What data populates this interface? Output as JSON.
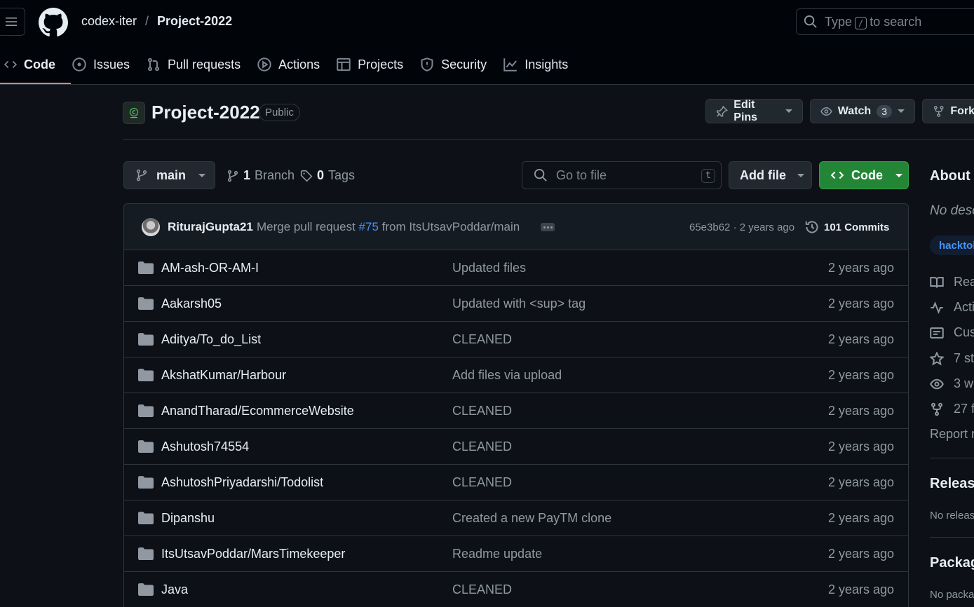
{
  "header": {
    "owner": "codex-iter",
    "separator": "/",
    "repo": "Project-2022",
    "search_prefix": "Type",
    "search_key": "/",
    "search_suffix": "to search"
  },
  "tabs": [
    {
      "label": "Code",
      "icon": "code-icon",
      "active": true
    },
    {
      "label": "Issues",
      "icon": "issue-icon"
    },
    {
      "label": "Pull requests",
      "icon": "pull-request-icon"
    },
    {
      "label": "Actions",
      "icon": "play-icon"
    },
    {
      "label": "Projects",
      "icon": "table-icon"
    },
    {
      "label": "Security",
      "icon": "shield-icon"
    },
    {
      "label": "Insights",
      "icon": "graph-icon"
    }
  ],
  "repo": {
    "title": "Project-2022",
    "visibility": "Public",
    "edit_pins": "Edit Pins",
    "watch": "Watch",
    "watch_count": "3",
    "fork": "Fork"
  },
  "branch": {
    "name": "main",
    "branch_count": "1",
    "branch_label": "Branch",
    "tag_count": "0",
    "tag_label": "Tags",
    "goto_placeholder": "Go to file",
    "goto_key": "t",
    "add_file": "Add file",
    "code": "Code"
  },
  "commit": {
    "author": "RiturajGupta21",
    "msg_prefix": "Merge pull request",
    "pr": "#75",
    "msg_suffix": "from ItsUtsavPoddar/main",
    "hash_time": "65e3b62 · 2 years ago",
    "count_label": "101 Commits"
  },
  "files": [
    {
      "name": "AM-ash-OR-AM-I",
      "message": "Updated files",
      "date": "2 years ago"
    },
    {
      "name": "Aakarsh05",
      "message": "Updated with <sup> tag",
      "date": "2 years ago"
    },
    {
      "name": "Aditya/To_do_List",
      "message": "CLEANED",
      "date": "2 years ago"
    },
    {
      "name": "AkshatKumar/Harbour",
      "message": "Add files via upload",
      "date": "2 years ago"
    },
    {
      "name": "AnandTharad/EcommerceWebsite",
      "message": "CLEANED",
      "date": "2 years ago"
    },
    {
      "name": "Ashutosh74554",
      "message": "CLEANED",
      "date": "2 years ago"
    },
    {
      "name": "AshutoshPriyadarshi/Todolist",
      "message": "CLEANED",
      "date": "2 years ago"
    },
    {
      "name": "Dipanshu",
      "message": "Created a new PayTM clone",
      "date": "2 years ago"
    },
    {
      "name": "ItsUtsavPoddar/MarsTimekeeper",
      "message": "Readme update",
      "date": "2 years ago"
    },
    {
      "name": "Java",
      "message": "CLEANED",
      "date": "2 years ago"
    }
  ],
  "sidebar": {
    "about": "About",
    "description": "No desc",
    "topic": "hacktob",
    "items": [
      {
        "label": "Rea",
        "icon": "book-icon"
      },
      {
        "label": "Acti",
        "icon": "pulse-icon"
      },
      {
        "label": "Cus",
        "icon": "note-icon"
      },
      {
        "label": "7 st",
        "icon": "star-icon"
      },
      {
        "label": "3 w",
        "icon": "eye-icon"
      },
      {
        "label": "27 f",
        "icon": "fork-icon"
      }
    ],
    "report": "Report r",
    "releases": "Release",
    "no_releases": "No releas",
    "packages": "Packag",
    "no_packages": "No packa"
  },
  "colors": {
    "accent_tab": "#f78166",
    "code_button": "#238636",
    "link": "#4493f8"
  }
}
